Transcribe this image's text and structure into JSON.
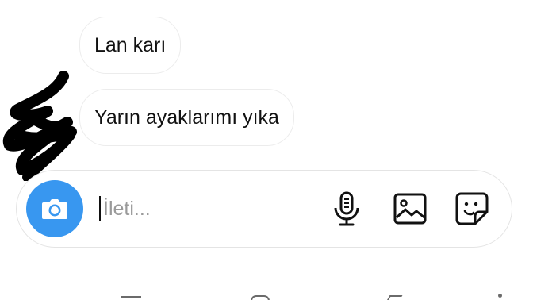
{
  "messages": [
    {
      "text": "Lan karı"
    },
    {
      "text": "Yarın ayaklarımı yıka"
    }
  ],
  "composer": {
    "placeholder": "İleti...",
    "camera_icon": "camera-icon",
    "mic_icon": "microphone-icon",
    "gallery_icon": "image-gallery-icon",
    "sticker_icon": "sticker-icon"
  },
  "colors": {
    "accent": "#3897f0",
    "bubble_border": "#ececec",
    "text": "#111111",
    "placeholder": "#9a9a9a"
  },
  "navbar": {
    "items": [
      "recents-icon",
      "home-icon",
      "back-icon",
      "assist-dot-icon"
    ]
  }
}
